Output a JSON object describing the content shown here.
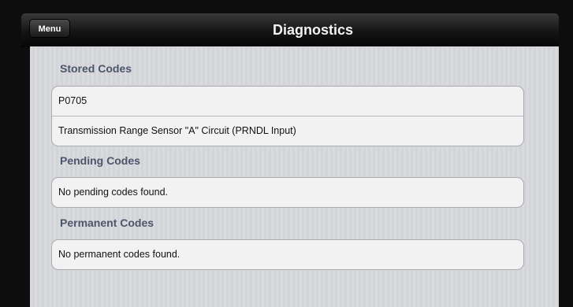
{
  "navbar": {
    "menu_label": "Menu",
    "title": "Diagnostics"
  },
  "sections": {
    "stored": {
      "header": "Stored Codes",
      "rows": [
        "P0705",
        "Transmission Range Sensor \"A\" Circuit (PRNDL Input)"
      ]
    },
    "pending": {
      "header": "Pending Codes",
      "rows": [
        "No pending codes found."
      ]
    },
    "permanent": {
      "header": "Permanent Codes",
      "rows": [
        "No permanent codes found."
      ]
    }
  },
  "colors": {
    "section_header": "#4c566a",
    "background": "#d6d8dc",
    "cell": "#f2f2f2"
  }
}
